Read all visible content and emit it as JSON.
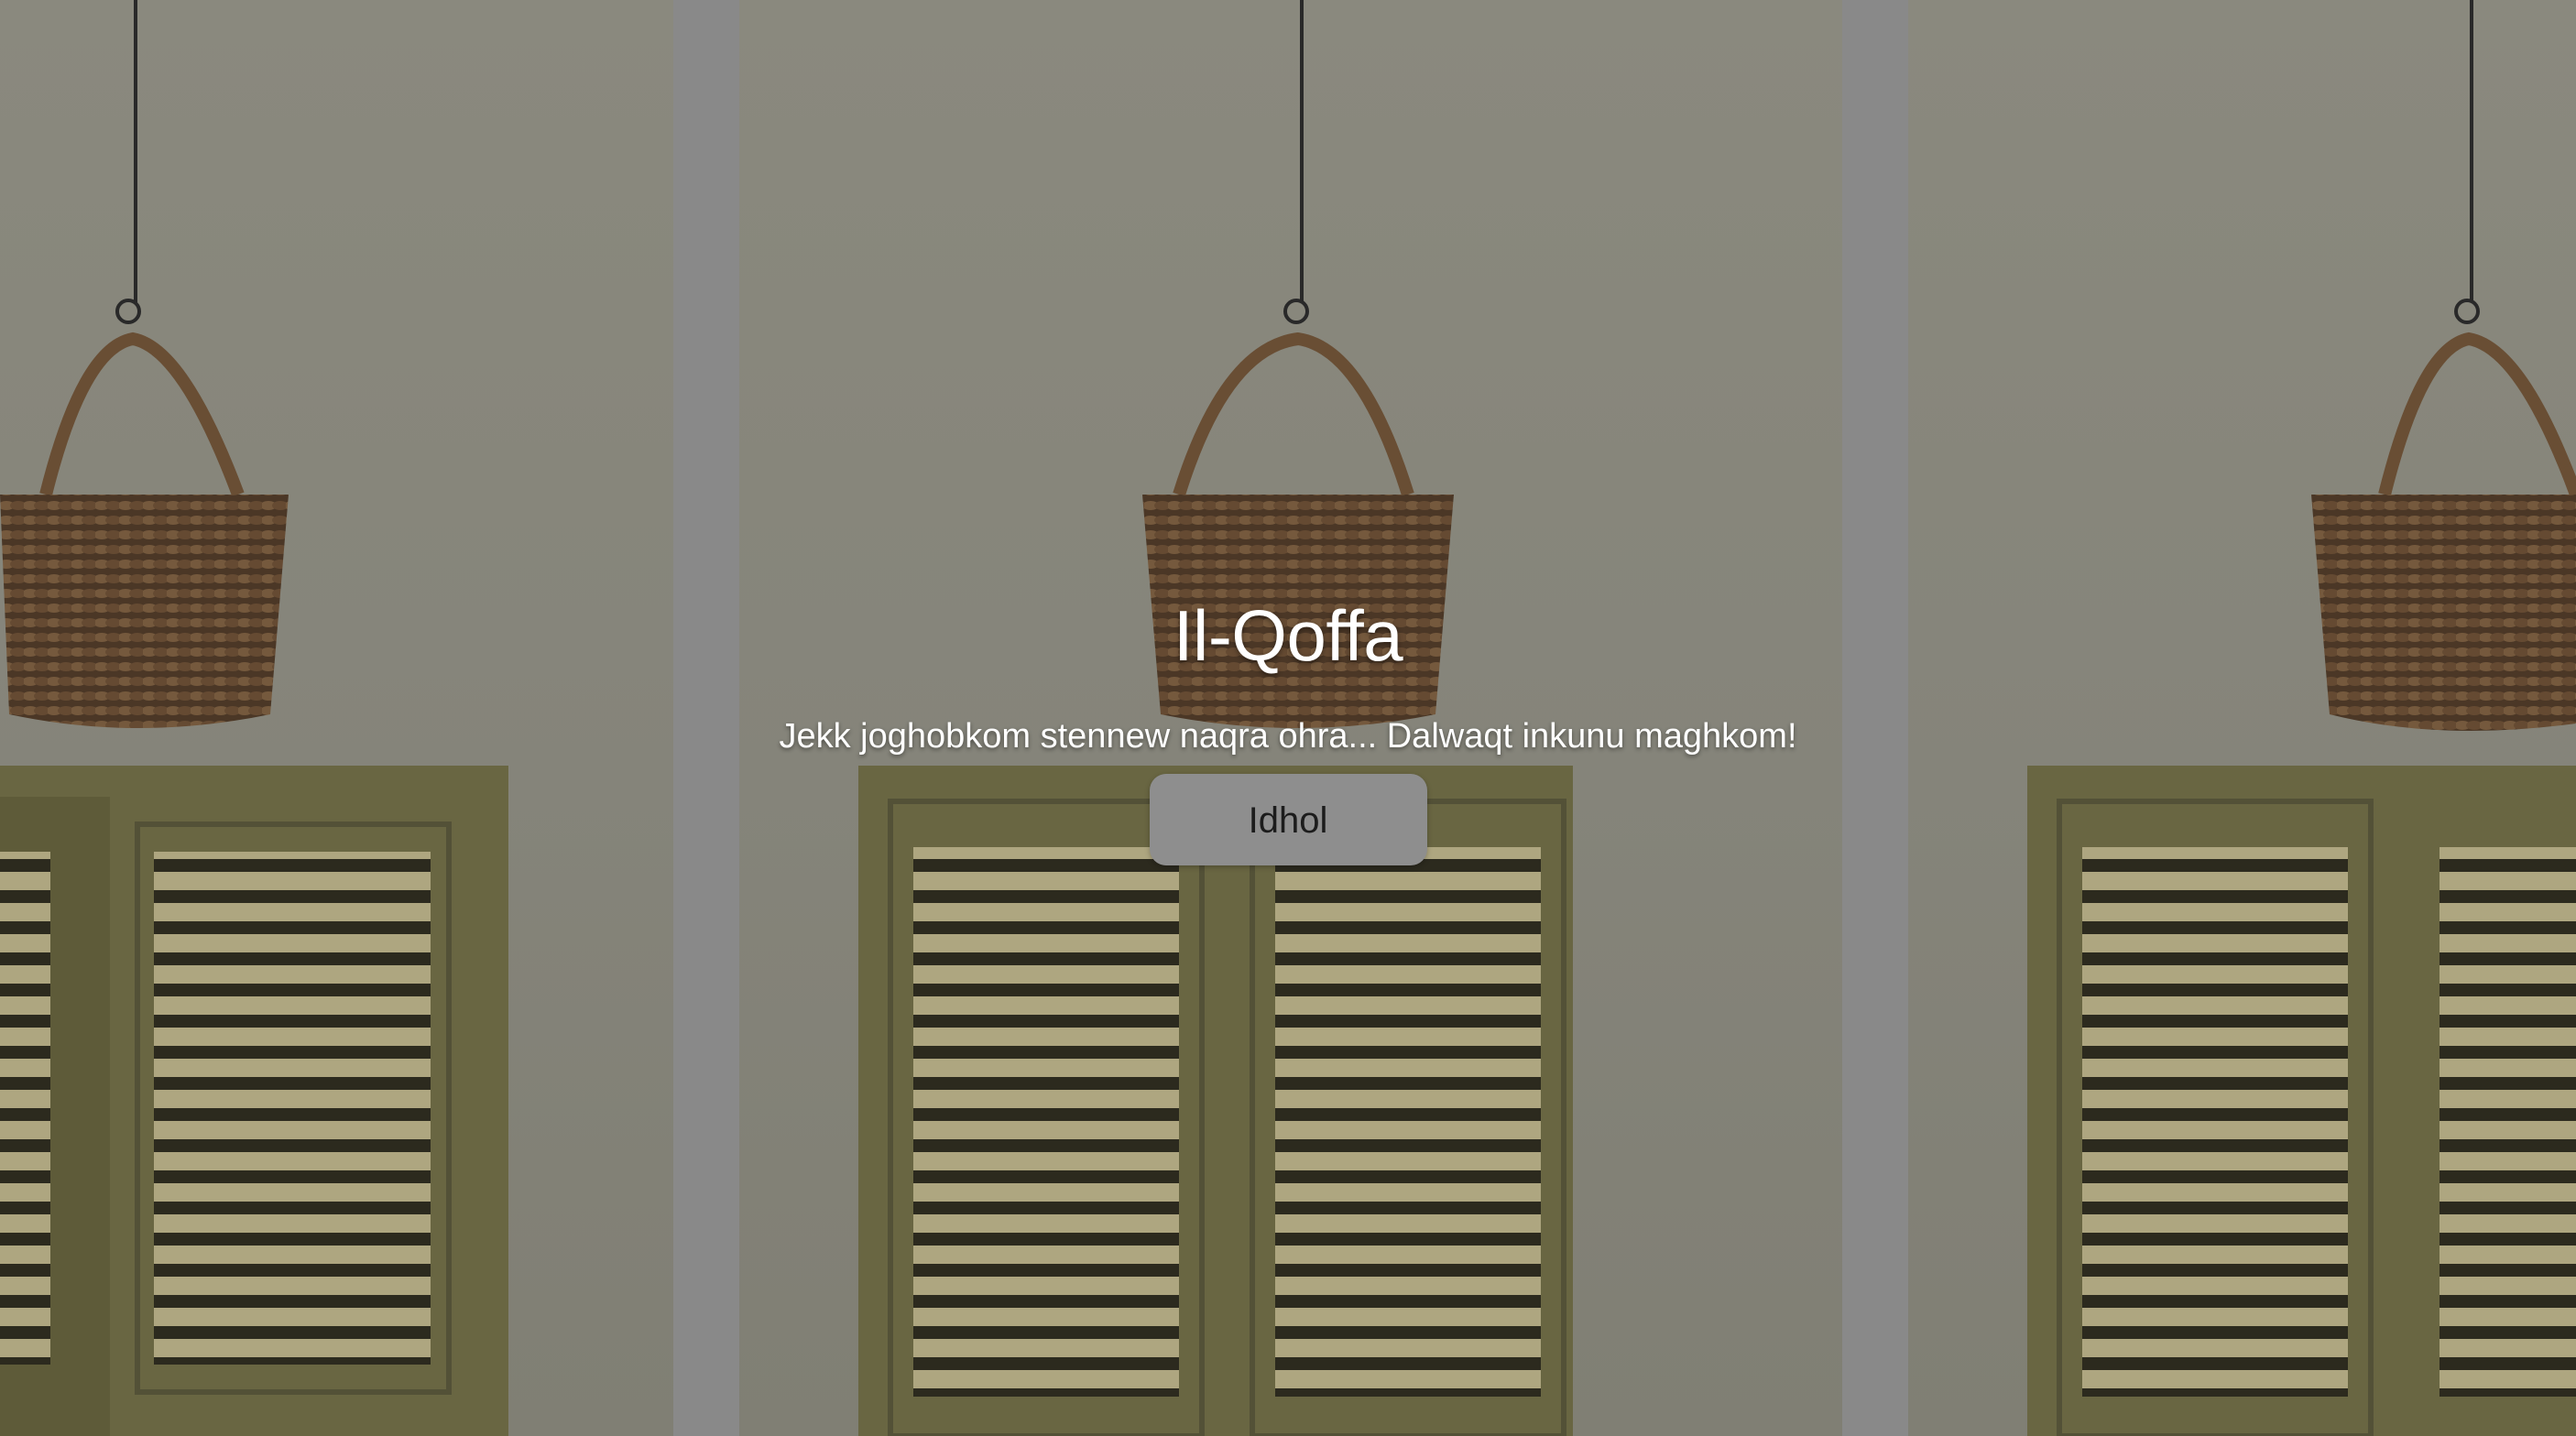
{
  "hero": {
    "title": "Il-Qoffa",
    "subtitle": "Jekk joghobkom stennew naqra ohra... Dalwaqt inkunu maghkom!",
    "button_label": "Idhol"
  },
  "colors": {
    "wall": "#8f8e83",
    "shutter": "#6f6c45",
    "basket": "#5a4330",
    "separator": "#8f8f8f",
    "button_bg": "#8e8e8e"
  },
  "background_images": [
    "basket-and-shutters-photo",
    "basket-and-shutters-photo",
    "basket-and-shutters-photo"
  ]
}
